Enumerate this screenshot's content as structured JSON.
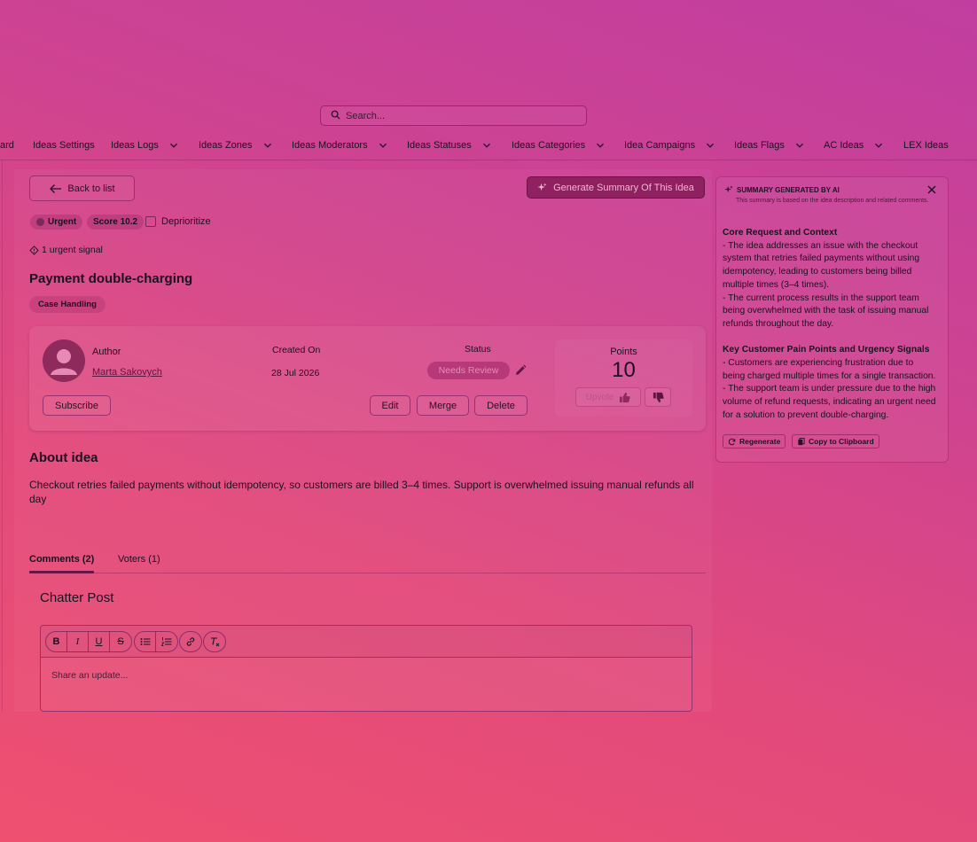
{
  "search": {
    "placeholder": "Search..."
  },
  "nav": [
    {
      "label": "ard",
      "dropdown": false
    },
    {
      "label": "Ideas Settings",
      "dropdown": false
    },
    {
      "label": "Ideas Logs",
      "dropdown": true
    },
    {
      "label": "Ideas Zones",
      "dropdown": true
    },
    {
      "label": "Ideas Moderators",
      "dropdown": true
    },
    {
      "label": "Ideas Statuses",
      "dropdown": true
    },
    {
      "label": "Ideas Categories",
      "dropdown": true
    },
    {
      "label": "Idea Campaigns",
      "dropdown": true
    },
    {
      "label": "Ideas Flags",
      "dropdown": true
    },
    {
      "label": "AC Ideas",
      "dropdown": true
    },
    {
      "label": "LEX Ideas",
      "dropdown": false
    }
  ],
  "actions": {
    "back": "Back to list",
    "generate": "Generate Summary Of This Idea"
  },
  "badges": {
    "urgent": "Urgent",
    "score": "Score 10.2",
    "deprioritize": "Deprioritize",
    "signal": "1 urgent signal"
  },
  "idea": {
    "title": "Payment double-charging",
    "category": "Case Handling",
    "author_label": "Author",
    "author_name": "Marta Sakovych",
    "created_label": "Created On",
    "created_value": "28 Jul 2026",
    "status_label": "Status",
    "status_value": "Needs Review",
    "points_label": "Points",
    "points_value": "10",
    "upvote": "Upvote",
    "subscribe": "Subscribe",
    "edit": "Edit",
    "merge": "Merge",
    "delete": "Delete"
  },
  "about": {
    "title": "About idea",
    "text": "Checkout retries failed payments without idempotency, so customers are billed 3–4 times. Support is overwhelmed issuing manual refunds all day"
  },
  "tabs": {
    "comments": "Comments (2)",
    "voters": "Voters (1)"
  },
  "chatter": {
    "title": "Chatter Post",
    "placeholder": "Share an update..."
  },
  "summary": {
    "header": "SUMMARY GENERATED BY AI",
    "subheader": "This summary is based on the idea description and related comments.",
    "section1_title": "Core Request and Context",
    "section1_lines": [
      "- The idea addresses an issue with the checkout",
      "system that retries failed payments without using",
      "idempotency, leading to customers being billed",
      "multiple times (3–4 times).",
      "- The current process results in the support team",
      "being overwhelmed with the task of issuing manual",
      "refunds throughout the day."
    ],
    "section2_title": "Key Customer Pain Points and Urgency Signals",
    "section2_lines": [
      "- Customers are experiencing frustration due to",
      "being charged multiple times for a single transaction.",
      "- The support team is under pressure due to the high",
      "volume of refund requests, indicating an urgent need",
      "for a solution to prevent double-charging."
    ],
    "regenerate": "Regenerate",
    "copy": "Copy to Clipboard"
  }
}
